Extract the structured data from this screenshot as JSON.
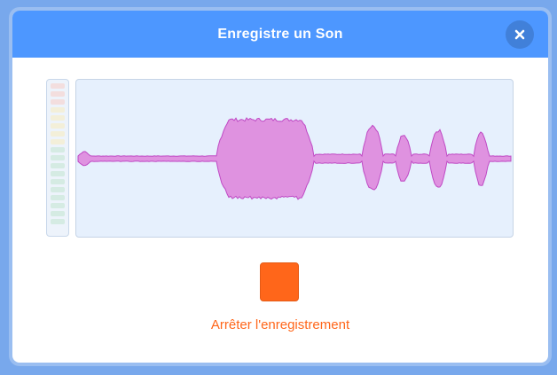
{
  "dialog": {
    "title": "Enregistre un Son",
    "close_icon": "close-icon",
    "stop_label": "Arrêter l'enregistrement"
  },
  "colors": {
    "header": "#4d97ff",
    "waveform_fill": "#df92e0",
    "waveform_stroke": "#bf49c4",
    "stop_button": "#ff661a",
    "meter_red": "#f3dede",
    "meter_yellow": "#f3efd9",
    "meter_green": "#d5ebe3"
  },
  "meter": {
    "segments": [
      "red",
      "red",
      "red",
      "yellow",
      "yellow",
      "yellow",
      "yellow",
      "yellow",
      "green",
      "green",
      "green",
      "green",
      "green",
      "green",
      "green",
      "green",
      "green",
      "green"
    ]
  }
}
